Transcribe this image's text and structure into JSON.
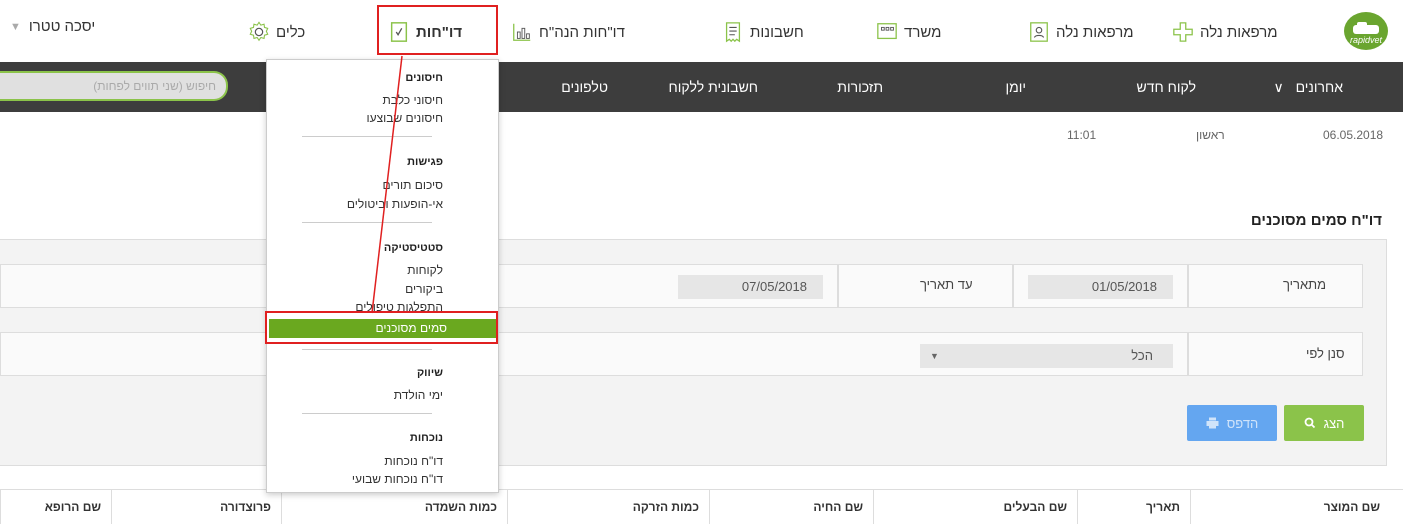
{
  "toolbar": {
    "logo_text": "rapidvet",
    "items": [
      {
        "label": "מרפאות נלה"
      },
      {
        "label": "מרפאות נלה"
      },
      {
        "label": "משרד"
      },
      {
        "label": "חשבונות"
      },
      {
        "label": "דו\"חות הנה\"ח"
      },
      {
        "label": "דו\"חות"
      },
      {
        "label": "כלים"
      }
    ],
    "user": "יסכה טטרו"
  },
  "nav": {
    "items": [
      "אחרונים",
      "לקוח חדש",
      "יומן",
      "תזכורות",
      "חשבונית ללקוח",
      "טלפונים"
    ],
    "search_placeholder": "חיפוש (שני תווים לפחות)"
  },
  "status": {
    "date": "06.05.2018",
    "day": "ראשון",
    "time": "11:01"
  },
  "page_title": "דו\"ח סמים מסוכנים",
  "filters": {
    "from_label": "מתאריך",
    "from_value": "01/05/2018",
    "to_label": "עד תאריך",
    "to_value": "07/05/2018",
    "filter_label": "סנן לפי",
    "filter_value": "הכל",
    "show_button": "הצג",
    "print_button": "הדפס"
  },
  "table": {
    "columns": [
      "שם המוצר",
      "תאריך",
      "שם הבעלים",
      "שם החיה",
      "כמות הזרקה",
      "כמות השמדה",
      "פרוצדורה",
      "שם הרופא"
    ]
  },
  "menu": {
    "sections": [
      {
        "title": "חיסונים",
        "items": [
          "חיסוני כלבת",
          "חיסונים שבוצעו"
        ]
      },
      {
        "title": "פגישות",
        "items": [
          "סיכום תורים",
          "אי-הופעות וביטולים"
        ]
      },
      {
        "title": "סטטיסטיקה",
        "items": [
          "לקוחות",
          "ביקורים",
          "התפלגות טיפולים",
          "סמים מסוכנים"
        ]
      },
      {
        "title": "שיווק",
        "items": [
          "ימי הולדת"
        ]
      },
      {
        "title": "נוכחות",
        "items": [
          "דו\"ח נוכחות",
          "דו\"ח נוכחות שבועי"
        ]
      }
    ]
  },
  "colors": {
    "accent_green": "#8bc34a",
    "menu_active": "#6aa81f",
    "nav_dark": "#3d3d3d",
    "highlight_red": "#e02020",
    "print_blue": "#64a6f0"
  }
}
